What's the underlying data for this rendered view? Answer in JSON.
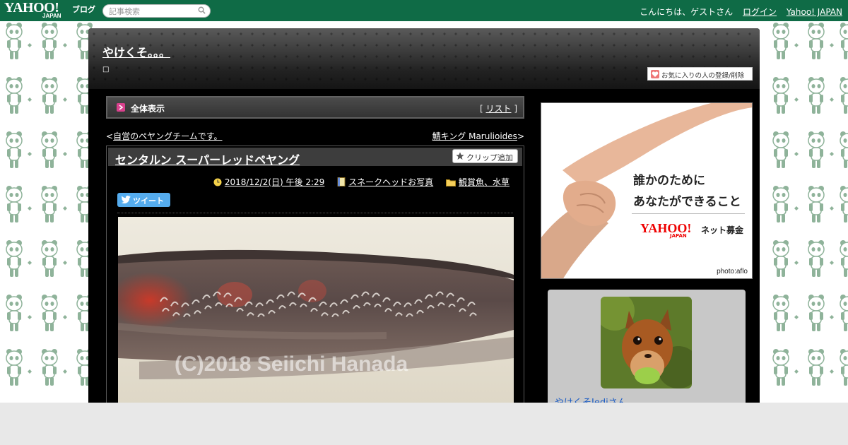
{
  "topbar": {
    "logo_yahoo": "YAHOO!",
    "logo_japan": "JAPAN",
    "logo_blog": "ブログ",
    "search_placeholder": "記事検索",
    "greeting": "こんにちは、ゲストさん",
    "login": "ログイン",
    "yahoo_japan": "Yahoo! JAPAN"
  },
  "blog": {
    "title": "やけくそ。。。",
    "subtitle": "□",
    "favorite_button": "お気に入りの人の登録/削除"
  },
  "list_bar": {
    "title": "全体表示",
    "list_prefix": "[ ",
    "list_link": "リスト",
    "list_suffix": " ]"
  },
  "nav": {
    "prev_arrow": "<",
    "prev_link": "自営のペヤングチームです。",
    "next_link": "鯖キング Marulioides",
    "next_arrow": ">"
  },
  "entry": {
    "title": "センタルン スーパーレッドペヤング",
    "clip_button": "クリップ追加",
    "date": "2018/12/2(日) 午後 2:29",
    "category": "スネークヘッドお写真",
    "folder": "観賞魚、水草",
    "tweet_button": "ツイート",
    "photo_watermark": "(C)2018 Seiichi Hanada"
  },
  "ad": {
    "line1": "誰かのために",
    "line2": "あなたができること",
    "logo": "YAHOO!",
    "logo_japan": "JAPAN",
    "label": "ネット募金",
    "credit": "photo:aflo"
  },
  "profile": {
    "name": "やけくそJediさん"
  },
  "colors": {
    "topbar": "#0f6b46",
    "frame": "#000000",
    "link_blue": "#1a5bc4",
    "tweet_blue": "#55acee",
    "panda_green": "#8fb39a"
  }
}
